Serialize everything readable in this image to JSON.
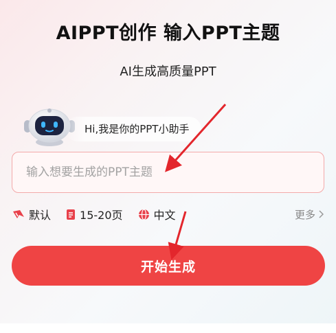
{
  "header": {
    "title": "AIPPT创作  输入PPT主题",
    "subtitle": "AI生成高质量PPT"
  },
  "assistant": {
    "greeting": "Hi,我是你的PPT小助手"
  },
  "topic_input": {
    "placeholder": "输入想要生成的PPT主题",
    "value": ""
  },
  "options": {
    "style_label": "默认",
    "pages_label": "15-20页",
    "language_label": "中文",
    "more_label": "更多"
  },
  "start_button": {
    "label": "开始生成"
  },
  "colors": {
    "accent": "#ef4444",
    "input_border": "#f3a9a9",
    "annotation_arrow": "#e3262c"
  }
}
